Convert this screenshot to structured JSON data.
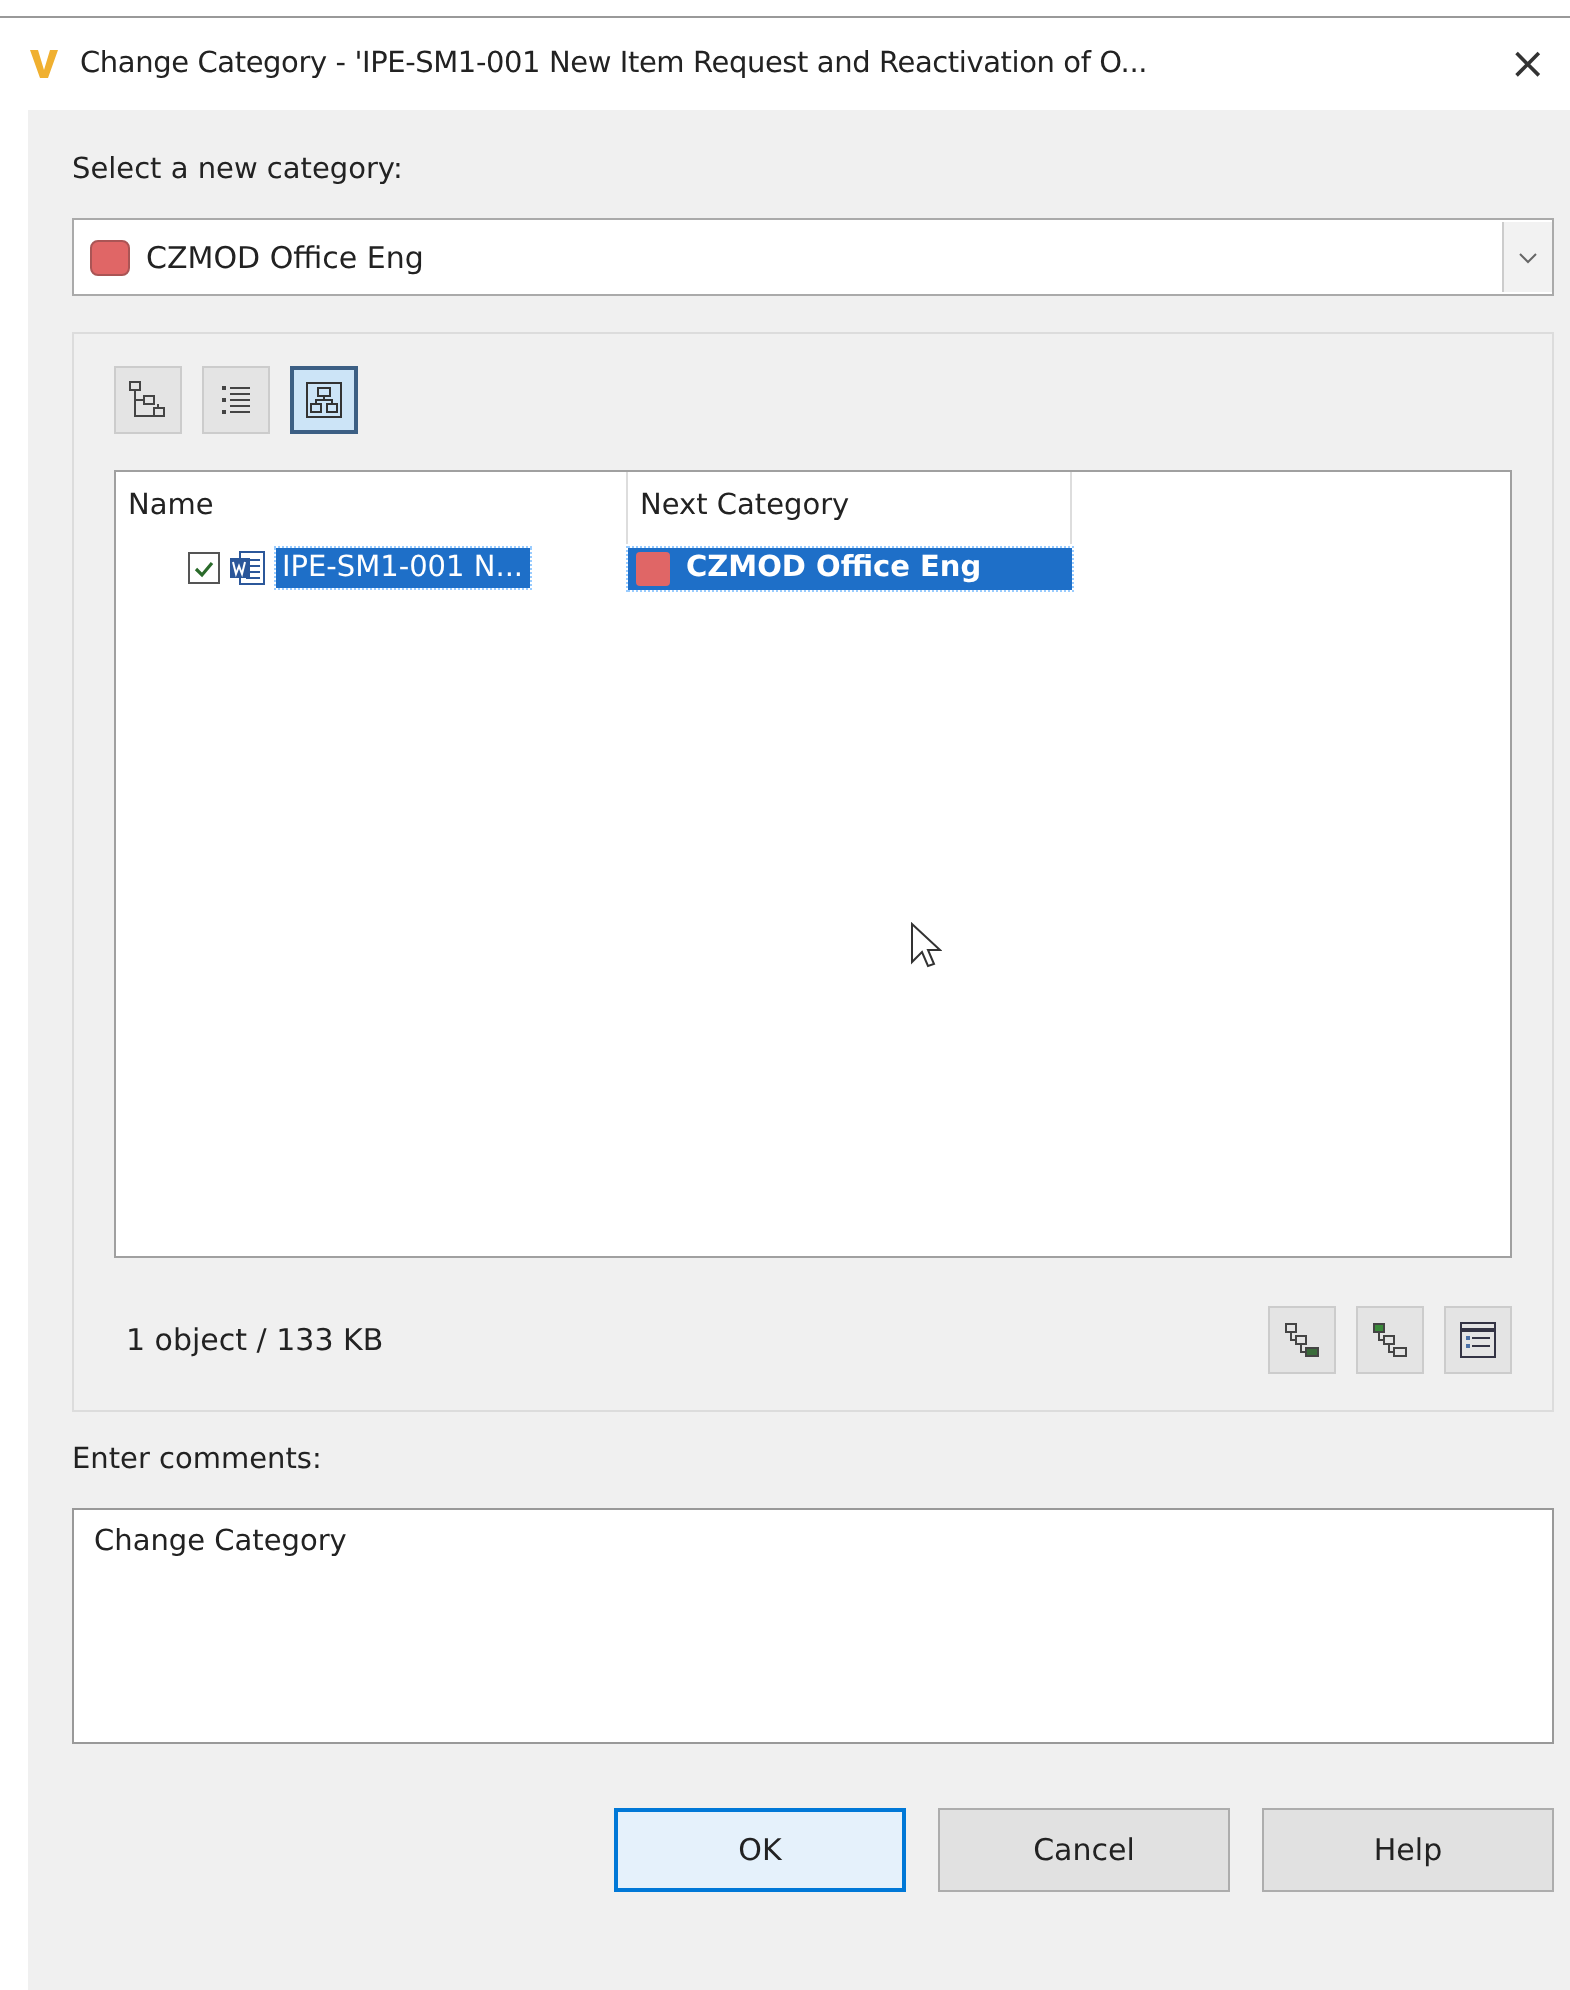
{
  "window": {
    "title": "Change Category - 'IPE-SM1-001 New Item Request and Reactivation of O...",
    "close": "×"
  },
  "category_label": "Select a new category:",
  "category": {
    "value": "CZMOD Office Eng",
    "color": "#e06666"
  },
  "view_buttons": [
    {
      "kind": "tree",
      "selected": false
    },
    {
      "kind": "list",
      "selected": false
    },
    {
      "kind": "grouped",
      "selected": true
    }
  ],
  "table": {
    "columns": [
      "Name",
      "Next Category"
    ],
    "rows": [
      {
        "name": "IPE-SM1-001 N...",
        "checked": true,
        "selected": true,
        "next_category": "CZMOD Office Eng",
        "color": "#e06666"
      }
    ]
  },
  "status": "1 object / 133 KB",
  "action_buttons": [
    {
      "kind": "expand"
    },
    {
      "kind": "expand-selected"
    },
    {
      "kind": "details"
    }
  ],
  "comments_label": "Enter comments:",
  "comments": {
    "value": "Change Category"
  },
  "buttons": [
    {
      "label": "OK",
      "default": true
    },
    {
      "label": "Cancel",
      "default": false
    },
    {
      "label": "Help",
      "default": false
    }
  ]
}
